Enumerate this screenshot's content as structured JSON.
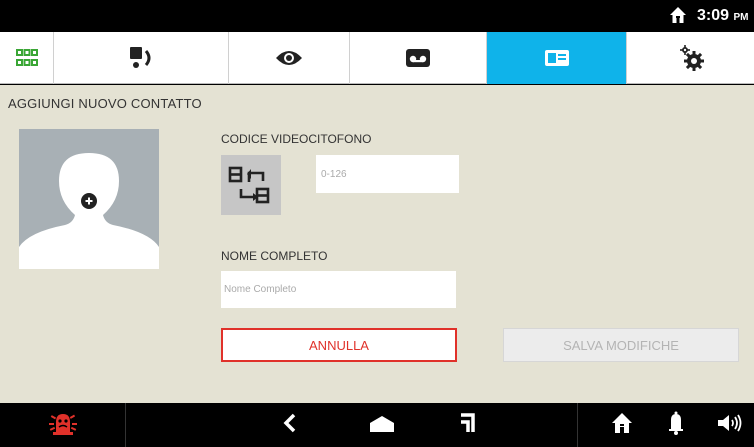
{
  "status_bar": {
    "time": "3:09",
    "ampm": "PM",
    "home_icon": "home-icon"
  },
  "tabs": [
    {
      "icon": "grid-apps-icon",
      "active": false,
      "color": "#3aa635"
    },
    {
      "icon": "intercom-call-icon",
      "active": false
    },
    {
      "icon": "eye-icon",
      "active": false
    },
    {
      "icon": "voicemail-icon",
      "active": false
    },
    {
      "icon": "contact-card-icon",
      "active": true
    },
    {
      "icon": "settings-gears-icon",
      "active": false
    }
  ],
  "main": {
    "title": "AGGIUNGI NUOVO CONTATTO",
    "avatar_icon": "add-avatar-icon",
    "code_label": "CODICE VIDEOCITOFONO",
    "code_placeholder": "0-126",
    "swap_icon": "swap-address-icon",
    "name_label": "NOME COMPLETO",
    "name_placeholder": "Nome Completo",
    "cancel_label": "ANNULLA",
    "save_label": "SALVA MODIFICHE"
  },
  "nav": {
    "alarm_icon": "alarm-siren-icon",
    "back_icon": "back-chevron-icon",
    "home_icon": "home-shape-icon",
    "recent_icon": "recent-apps-icon",
    "house_icon": "house-icon",
    "bell_icon": "bell-icon",
    "volume_icon": "volume-icon"
  },
  "colors": {
    "accent": "#0fb3ea",
    "cancel": "#e0312a",
    "alarm": "#e0312a",
    "background": "#e4e2d3"
  }
}
